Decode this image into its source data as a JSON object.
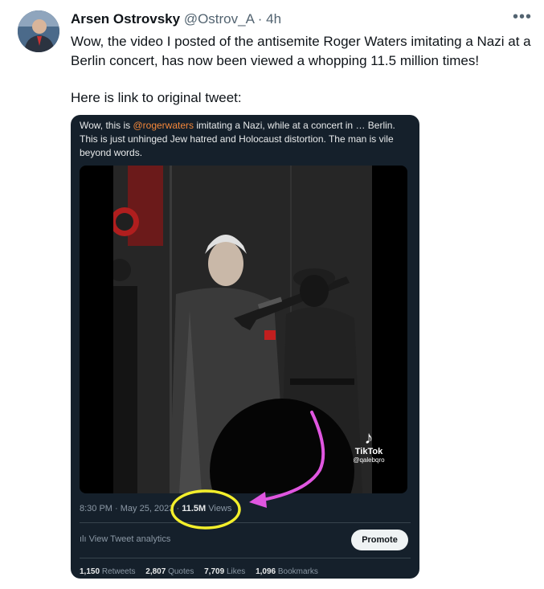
{
  "author": {
    "name": "Arsen Ostrovsky",
    "handle": "@Ostrov_A",
    "separator": "·",
    "time": "4h",
    "more_icon": "more-horizontal-icon"
  },
  "tweet": {
    "line1": "Wow,  the video I posted of the antisemite Roger Waters imitating a Nazi at a Berlin concert, has now been viewed a whopping 11.5 million times!",
    "line2": "Here is link to original tweet:"
  },
  "embed": {
    "text_before": "Wow, this is ",
    "mention": "@rogerwaters",
    "text_after": " imitating a Nazi, while at a concert in … Berlin. This is just unhinged Jew hatred and Holocaust distortion. The man is vile beyond words.",
    "mention_color": "#f4873a",
    "video": {
      "watermark_icon": "tiktok-logo-icon",
      "watermark_name": "TikTok",
      "watermark_handle": "@qalebqro"
    },
    "timestamp": "8:30 PM · May 25, 2023",
    "views_sep": "·",
    "views_count": "11.5M",
    "views_label": "Views",
    "analytics_icon": "bar-chart-icon",
    "analytics_label": "View Tweet analytics",
    "promote_label": "Promote",
    "stats": [
      {
        "count": "1,150",
        "label": "Retweets"
      },
      {
        "count": "2,807",
        "label": "Quotes"
      },
      {
        "count": "7,709",
        "label": "Likes"
      },
      {
        "count": "1,096",
        "label": "Bookmarks"
      }
    ]
  },
  "annotations": {
    "circle_color": "#f3ef2b",
    "arrow_color": "#e056e0"
  },
  "colors": {
    "embed_bg": "#15202b",
    "secondary_text": "#536471"
  }
}
